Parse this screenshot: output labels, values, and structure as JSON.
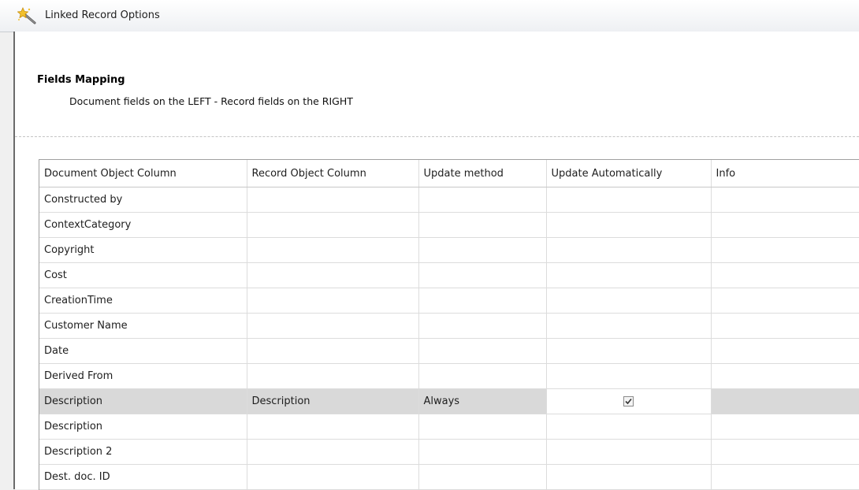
{
  "window": {
    "title": "Linked Record Options",
    "icon": "wand-icon"
  },
  "header": {
    "title": "Fields Mapping",
    "subtitle": "Document fields on the LEFT - Record fields on the RIGHT"
  },
  "grid": {
    "columns": [
      "Document Object Column",
      "Record Object Column",
      "Update method",
      "Update Automatically",
      "Info"
    ],
    "rows": [
      {
        "doc": "Constructed by",
        "rec": "",
        "method": "",
        "auto": false,
        "info": "",
        "selected": false
      },
      {
        "doc": "ContextCategory",
        "rec": "",
        "method": "",
        "auto": false,
        "info": "",
        "selected": false
      },
      {
        "doc": "Copyright",
        "rec": "",
        "method": "",
        "auto": false,
        "info": "",
        "selected": false
      },
      {
        "doc": "Cost",
        "rec": "",
        "method": "",
        "auto": false,
        "info": "",
        "selected": false
      },
      {
        "doc": "CreationTime",
        "rec": "",
        "method": "",
        "auto": false,
        "info": "",
        "selected": false
      },
      {
        "doc": "Customer Name",
        "rec": "",
        "method": "",
        "auto": false,
        "info": "",
        "selected": false
      },
      {
        "doc": "Date",
        "rec": "",
        "method": "",
        "auto": false,
        "info": "",
        "selected": false
      },
      {
        "doc": "Derived From",
        "rec": "",
        "method": "",
        "auto": false,
        "info": "",
        "selected": false
      },
      {
        "doc": "Description",
        "rec": "Description",
        "method": "Always",
        "auto": true,
        "info": "",
        "selected": true
      },
      {
        "doc": "Description",
        "rec": "",
        "method": "",
        "auto": false,
        "info": "",
        "selected": false
      },
      {
        "doc": "Description 2",
        "rec": "",
        "method": "",
        "auto": false,
        "info": "",
        "selected": false
      },
      {
        "doc": "Dest. doc. ID",
        "rec": "",
        "method": "",
        "auto": false,
        "info": "",
        "selected": false
      }
    ]
  }
}
